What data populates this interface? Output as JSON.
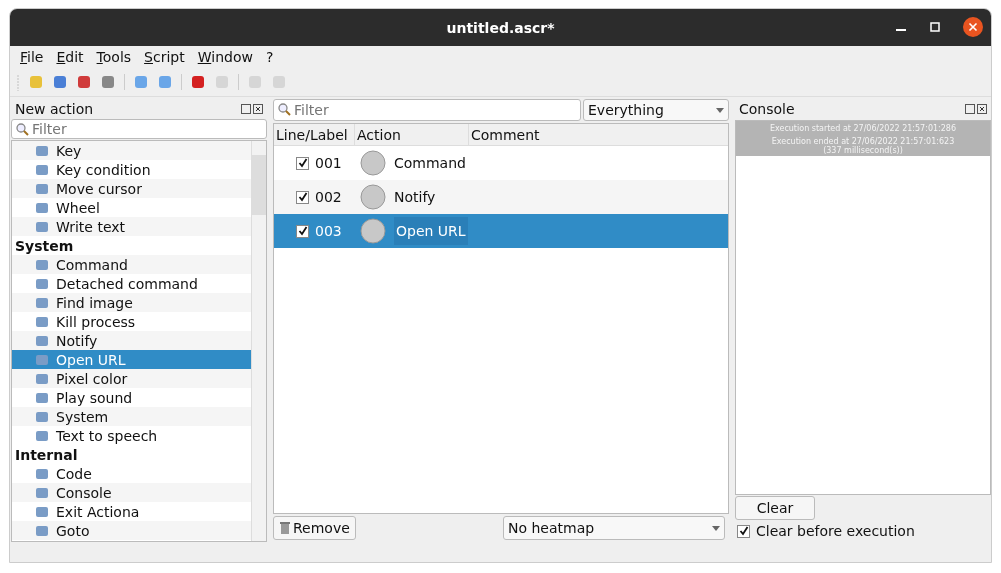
{
  "window": {
    "title": "untitled.ascr*"
  },
  "menu": [
    "File",
    "Edit",
    "Tools",
    "Script",
    "Window",
    "?"
  ],
  "toolbar": [
    {
      "kind": "action",
      "disabled": false
    },
    {
      "kind": "action",
      "disabled": false
    },
    {
      "kind": "action",
      "disabled": false
    },
    {
      "kind": "action",
      "disabled": false
    },
    {
      "kind": "separator"
    },
    {
      "kind": "action",
      "disabled": false
    },
    {
      "kind": "action",
      "disabled": false
    },
    {
      "kind": "separator"
    },
    {
      "kind": "action",
      "disabled": false
    },
    {
      "kind": "action",
      "disabled": true
    },
    {
      "kind": "separator"
    },
    {
      "kind": "action",
      "disabled": true
    },
    {
      "kind": "action",
      "disabled": true
    }
  ],
  "new_action": {
    "title": "New action",
    "filter": {
      "placeholder": "Filter"
    },
    "items": [
      {
        "kind": "action",
        "label": "Key",
        "selected": false
      },
      {
        "kind": "action",
        "label": "Key condition",
        "selected": false
      },
      {
        "kind": "action",
        "label": "Move cursor",
        "selected": false
      },
      {
        "kind": "action",
        "label": "Wheel",
        "selected": false
      },
      {
        "kind": "action",
        "label": "Write text",
        "selected": false
      },
      {
        "kind": "category",
        "label": "System",
        "selected": false
      },
      {
        "kind": "action",
        "label": "Command",
        "selected": false
      },
      {
        "kind": "action",
        "label": "Detached command",
        "selected": false
      },
      {
        "kind": "action",
        "label": "Find image",
        "selected": false
      },
      {
        "kind": "action",
        "label": "Kill process",
        "selected": false
      },
      {
        "kind": "action",
        "label": "Notify",
        "selected": false
      },
      {
        "kind": "action",
        "label": "Open URL",
        "selected": true
      },
      {
        "kind": "action",
        "label": "Pixel color",
        "selected": false
      },
      {
        "kind": "action",
        "label": "Play sound",
        "selected": false
      },
      {
        "kind": "action",
        "label": "System",
        "selected": false
      },
      {
        "kind": "action",
        "label": "Text to speech",
        "selected": false
      },
      {
        "kind": "category",
        "label": "Internal",
        "selected": false
      },
      {
        "kind": "action",
        "label": "Code",
        "selected": false
      },
      {
        "kind": "action",
        "label": "Console",
        "selected": false
      },
      {
        "kind": "action",
        "label": "Exit Actiona",
        "selected": false
      },
      {
        "kind": "action",
        "label": "Goto",
        "selected": false
      }
    ]
  },
  "script": {
    "filter": {
      "placeholder": "Filter"
    },
    "scope": "Everything",
    "columns": [
      "Line/Label",
      "Action",
      "Comment"
    ],
    "rows": [
      {
        "enabled": true,
        "line": "001",
        "action": "Command",
        "comment": "",
        "selected": false
      },
      {
        "enabled": true,
        "line": "002",
        "action": "Notify",
        "comment": "",
        "selected": false
      },
      {
        "enabled": true,
        "line": "003",
        "action": "Open URL",
        "comment": "",
        "selected": true
      }
    ],
    "remove_button": "Remove",
    "heatmap": "No heatmap"
  },
  "console": {
    "title": "Console",
    "lines": [
      "Execution started at 27/06/2022 21:57:01:286",
      "Execution ended at 27/06/2022 21:57:01:623\n(337 millisecond(s))"
    ],
    "clear_button": "Clear",
    "clear_before_execution": {
      "label": "Clear before execution",
      "checked": true
    }
  }
}
